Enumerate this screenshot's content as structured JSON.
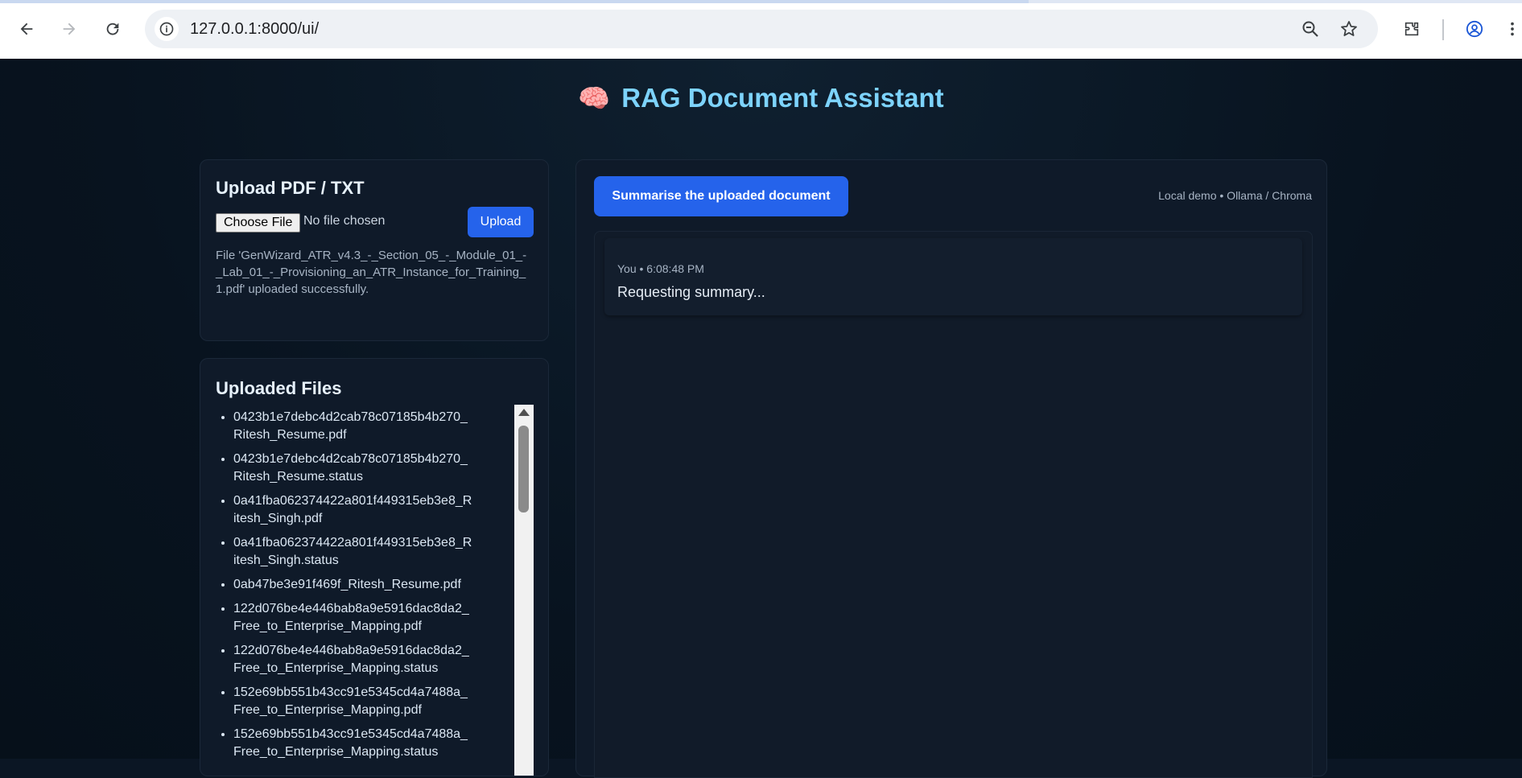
{
  "browser": {
    "url": "127.0.0.1:8000/ui/",
    "icons": {
      "back": "arrow-left-icon",
      "forward": "arrow-right-icon",
      "reload": "reload-icon",
      "site_info": "info-icon",
      "zoom": "zoom-out-icon",
      "bookmark": "star-icon",
      "extensions": "puzzle-icon",
      "profile": "account-circle-icon",
      "menu": "kebab-menu-icon"
    }
  },
  "app": {
    "emoji": "🧠",
    "title": "RAG Document Assistant"
  },
  "upload": {
    "heading": "Upload PDF / TXT",
    "choose_label": "Choose File",
    "no_file": "No file chosen",
    "upload_label": "Upload",
    "message": "File 'GenWizard_ATR_v4.3_-_Section_05_-_Module_01_-_Lab_01_-_Provisioning_an_ATR_Instance_for_Training_1.pdf' uploaded successfully."
  },
  "files": {
    "heading": "Uploaded Files",
    "items": [
      "0423b1e7debc4d2cab78c07185b4b270_Ritesh_Resume.pdf",
      "0423b1e7debc4d2cab78c07185b4b270_Ritesh_Resume.status",
      "0a41fba062374422a801f449315eb3e8_Ritesh_Singh.pdf",
      "0a41fba062374422a801f449315eb3e8_Ritesh_Singh.status",
      "0ab47be3e91f469f_Ritesh_Resume.pdf",
      "122d076be4e446bab8a9e5916dac8da2_Free_to_Enterprise_Mapping.pdf",
      "122d076be4e446bab8a9e5916dac8da2_Free_to_Enterprise_Mapping.status",
      "152e69bb551b43cc91e5345cd4a7488a_Free_to_Enterprise_Mapping.pdf",
      "152e69bb551b43cc91e5345cd4a7488a_Free_to_Enterprise_Mapping.status"
    ]
  },
  "chat": {
    "summarise_label": "Summarise the uploaded document",
    "meta": "Local demo • Ollama / Chroma",
    "messages": [
      {
        "meta": "You • 6:08:48 PM",
        "text": "Requesting summary..."
      }
    ]
  },
  "colors": {
    "accent": "#2563eb",
    "title": "#7dd3fc",
    "background": "#0b1624",
    "card": "#0f1a29"
  }
}
